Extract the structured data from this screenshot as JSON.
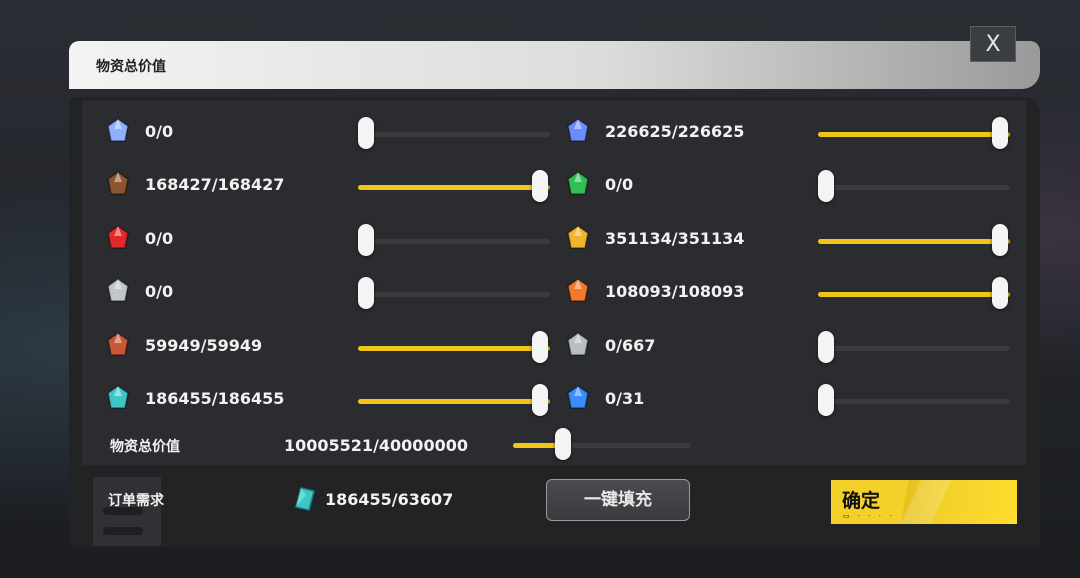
{
  "dialog": {
    "title": "物资总价值",
    "close_label": "X"
  },
  "materials": [
    {
      "value": "0/0",
      "fill": 0.0,
      "color": "#8fb0ff",
      "icon": "blue-crystal-cluster-icon"
    },
    {
      "value": "226625/226625",
      "fill": 1.0,
      "color": "#6a8cff",
      "icon": "blue-orb-icon"
    },
    {
      "value": "168427/168427",
      "fill": 1.0,
      "color": "#8a5530",
      "icon": "bread-loaf-icon"
    },
    {
      "value": "0/0",
      "fill": 0.0,
      "color": "#2fbf55",
      "icon": "green-gem-icon"
    },
    {
      "value": "0/0",
      "fill": 0.0,
      "color": "#e02a2a",
      "icon": "red-crystal-icon"
    },
    {
      "value": "351134/351134",
      "fill": 1.0,
      "color": "#f1b52d",
      "icon": "gold-bar-icon"
    },
    {
      "value": "0/0",
      "fill": 0.0,
      "color": "#c0c6cc",
      "icon": "steel-plates-icon"
    },
    {
      "value": "108093/108093",
      "fill": 1.0,
      "color": "#f07a2a",
      "icon": "orange-jar-icon"
    },
    {
      "value": "59949/59949",
      "fill": 1.0,
      "color": "#c8573a",
      "icon": "ore-chunk-icon"
    },
    {
      "value": "0/667",
      "fill": 0.0,
      "color": "#b9bec4",
      "icon": "silver-shard-icon"
    },
    {
      "value": "186455/186455",
      "fill": 1.0,
      "color": "#3fc7c7",
      "icon": "teal-crystal-icon"
    },
    {
      "value": "0/31",
      "fill": 0.0,
      "color": "#3a8cff",
      "icon": "blue-flame-crystal-icon"
    }
  ],
  "total": {
    "label": "物资总价值",
    "value": "10005521/40000000",
    "fill": 0.25
  },
  "order": {
    "label": "订单需求",
    "value": "186455/63607",
    "icon": "teal-crystal-icon"
  },
  "buttons": {
    "fill_all_label": "一键填充",
    "confirm_label": "确定"
  },
  "colors": {
    "accent": "#f2c51b",
    "confirm": "#f3d12a"
  }
}
